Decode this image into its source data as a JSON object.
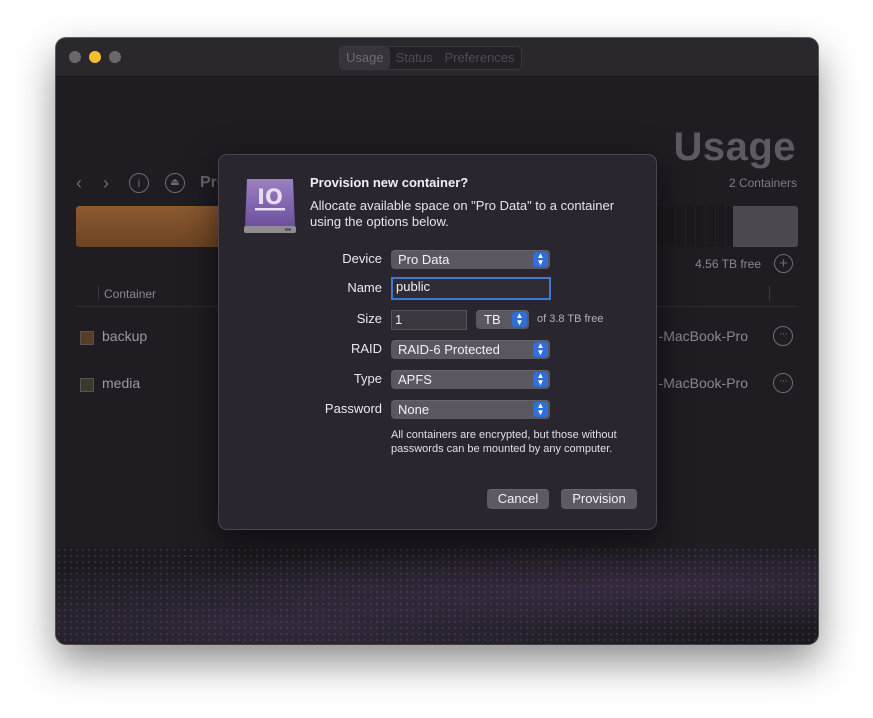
{
  "window": {
    "tabs": [
      {
        "label": "Usage",
        "selected": true
      },
      {
        "label": "Status",
        "selected": false
      },
      {
        "label": "Preferences",
        "selected": false
      }
    ]
  },
  "main": {
    "title": "Usage",
    "container_count": "2 Containers",
    "breadcrumb": "Pro Data",
    "free_space": "4.56 TB free",
    "column_header": "Container",
    "rows": [
      {
        "name": "backup",
        "host": "-MacBook-Pro"
      },
      {
        "name": "media",
        "host": "-MacBook-Pro"
      }
    ]
  },
  "dialog": {
    "title": "Provision new container?",
    "message": "Allocate available space on \"Pro Data\" to a container using the options below.",
    "icon_label": "IO",
    "fields": {
      "device": {
        "label": "Device",
        "value": "Pro Data"
      },
      "name": {
        "label": "Name",
        "value": "public"
      },
      "size": {
        "label": "Size",
        "value": "1",
        "unit": "TB",
        "free": "of 3.8 TB free"
      },
      "raid": {
        "label": "RAID",
        "value": "RAID-6 Protected"
      },
      "type": {
        "label": "Type",
        "value": "APFS"
      },
      "password": {
        "label": "Password",
        "value": "None"
      }
    },
    "note": "All containers are encrypted, but those without passwords can be mounted by any computer.",
    "buttons": {
      "cancel": "Cancel",
      "provision": "Provision"
    }
  },
  "colors": {
    "accent": "#2f6fd9",
    "window_bg": "#1f1c22",
    "dialog_bg": "#2a2630",
    "usage_bar": "#8c5a30"
  }
}
